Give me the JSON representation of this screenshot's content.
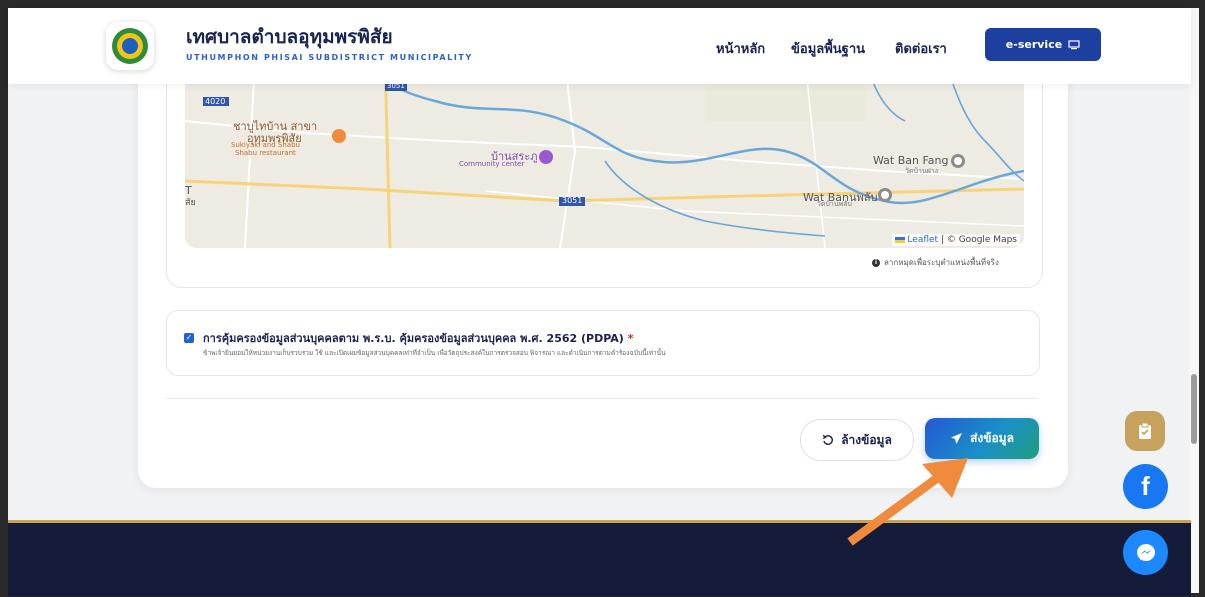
{
  "header": {
    "title": "เทศบาลตำบลอุทุมพรพิสัย",
    "subtitle": "UTHUMPHON PHISAI SUBDISTRICT MUNICIPALITY",
    "nav": [
      {
        "label": "หน้าหลัก"
      },
      {
        "label": "ข้อมูลพื้นฐาน"
      },
      {
        "label": "ติดต่อเรา"
      }
    ],
    "eservice_label": "e-service"
  },
  "map": {
    "labels": {
      "road_4020": "4020",
      "road_3051_top": "3051",
      "road_3051": "3051",
      "restaurant_th": "ชาบูไทบ้าน สาขา",
      "restaurant_th2": "อุทุมพรพิสัย",
      "restaurant_en": "Sukiyaki and Shabu",
      "restaurant_en2": "Shabu restaurant",
      "community_th": "บ้านสระภู",
      "community_en": "Community center",
      "wat_ban_fang": "Wat Ban Fang",
      "wat_ban_fang_th": "วัดบ้านฝาง",
      "wat_ban_phlap": "Wat Banนพลับ",
      "wat_ban_phlap_th": "วัดบ้านพลับ",
      "left_t": "T",
      "left_sai": "สัย"
    },
    "attribution_leaflet": "Leaflet",
    "attribution_google": "| © Google Maps",
    "hint": "ลากหมุดเพื่อระบุตำแหน่งพื้นที่จริง",
    "colors": {
      "land": "#eeebe2",
      "river": "#6aa7d9",
      "road_white": "#ffffff",
      "road_yellow": "#f6d27a"
    }
  },
  "pdpa": {
    "checked": true,
    "title": "การคุ้มครองข้อมูลส่วนบุคคลตาม พ.ร.บ. คุ้มครองข้อมูลส่วนบุคคล พ.ศ. 2562 (PDPA)",
    "required_mark": "*",
    "description": "ข้าพเจ้ายินยอมให้หน่วยงานเก็บรวบรวม ใช้ และเปิดเผยข้อมูลส่วนบุคคลเท่าที่จำเป็น เพื่อวัตถุประสงค์ในการตรวจสอบ พิจารณา และดำเนินการตามคำร้องฉบับนี้เท่านั้น"
  },
  "actions": {
    "reset_label": "ล้างข้อมูล",
    "submit_label": "ส่งข้อมูล"
  },
  "floating": {
    "facebook_glyph": "f"
  },
  "colors": {
    "primary": "#1d3fa0",
    "accent_gold": "#c6a25c",
    "facebook": "#1877f2",
    "messenger": "#1e88ff",
    "footer": "#141c3a",
    "arrow": "#f08a3c"
  }
}
